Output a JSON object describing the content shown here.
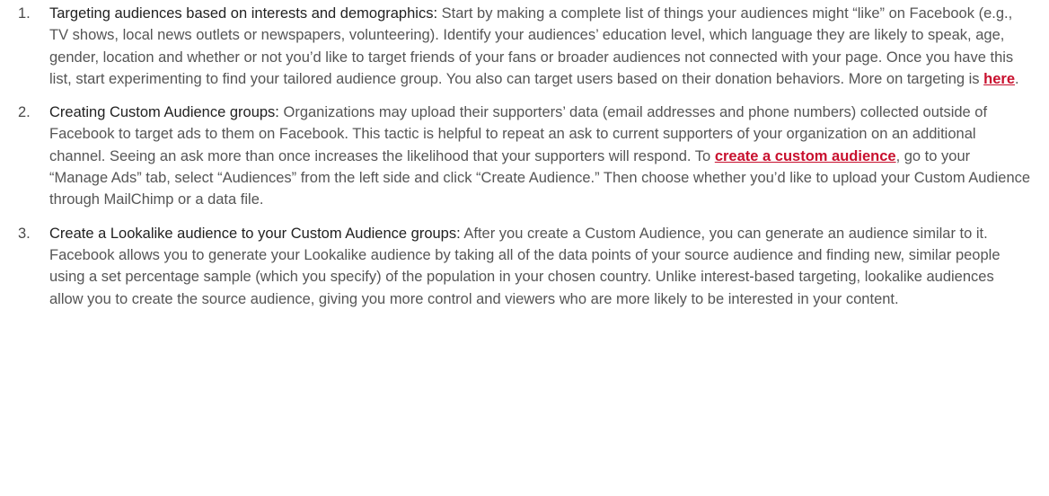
{
  "items": [
    {
      "number": "1.",
      "lead": "Targeting audiences based on interests and demographics:",
      "text_before": " Start by making a complete list of things your audiences might “like” on Facebook (e.g., TV shows, local news outlets or newspapers, volunteering). Identify your audiences’ education level, which language they are likely to speak, age, gender, location and whether or not you’d like to target friends of your fans or broader audiences not connected with your page. Once you have this list, start experimenting to find your tailored audience group. You also can target users based on their donation behaviors. More on targeting is ",
      "link": "here",
      "text_after": "."
    },
    {
      "number": "2.",
      "lead": "Creating Custom Audience groups:",
      "text_before": " Organizations may upload their supporters’ data (email addresses and phone numbers) collected outside of Facebook to target ads to them on Facebook. This tactic is helpful to repeat an ask to current supporters of your organization on an additional channel. Seeing an ask more than once increases the likelihood that your supporters will respond. To ",
      "link": "create a custom audience",
      "text_after": ", go to your “Manage Ads” tab, select “Audiences” from the left side and click “Create Audience.” Then choose whether you’d like to upload your Custom Audience through MailChimp or a data file."
    },
    {
      "number": "3.",
      "lead": "Create a Lookalike audience to your Custom Audience groups:",
      "text_before": " After you create a Custom Audience, you can generate an audience similar to it. Facebook allows you to generate your Lookalike audience by taking all of the data points of your source audience and finding new, similar people using a set percentage sample (which you specify) of the population in your chosen country. Unlike interest-based targeting, lookalike audiences allow you to create the source audience, giving you more control and viewers who are more likely to be interested in your content.",
      "link": "",
      "text_after": ""
    }
  ],
  "colors": {
    "link": "#c8102e",
    "lead_text": "#222222",
    "body_text": "#555555"
  }
}
